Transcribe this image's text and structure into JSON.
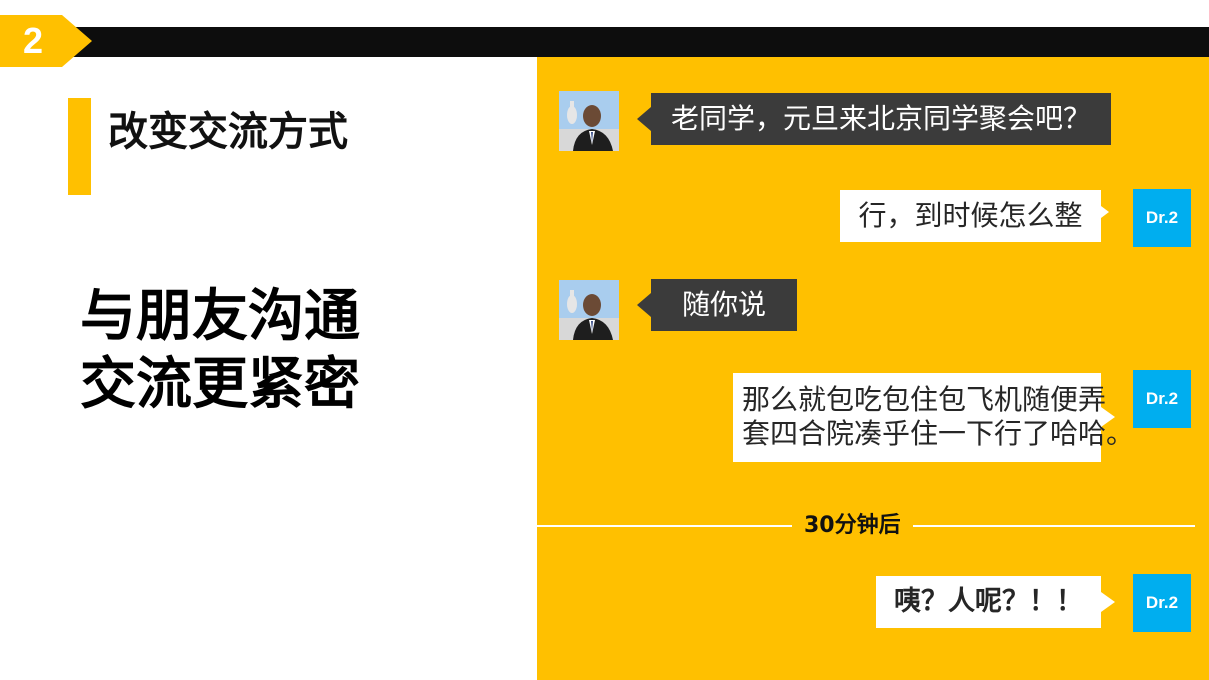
{
  "slide": {
    "number": "2",
    "section_title": "改变交流方式",
    "headline": [
      "与朋友沟通",
      "交流更紧密"
    ]
  },
  "chat": {
    "messages": [
      {
        "sender": "friend",
        "text": "老同学，元旦来北京同学聚会吧？"
      },
      {
        "sender": "me",
        "avatar_label": "Dr.2",
        "text": "行，到时候怎么整"
      },
      {
        "sender": "friend",
        "text": "随你说"
      },
      {
        "sender": "me",
        "avatar_label": "Dr.2",
        "lines": [
          "那么就包吃包住包飞机随便弄",
          "套四合院凑乎住一下行了哈哈。"
        ]
      },
      {
        "sender": "me",
        "avatar_label": "Dr.2",
        "text": "咦？人呢？！！"
      }
    ],
    "time_divider": "30分钟后"
  },
  "colors": {
    "accent_yellow": "#FFC000",
    "dark_bar": "#0d0d0d",
    "bubble_dark": "#3b3b3b",
    "avatar_blue": "#00AEEF"
  },
  "icons": {
    "slide_number_tag": "arrow-tag",
    "friend_avatar": "portrait-avatar"
  }
}
